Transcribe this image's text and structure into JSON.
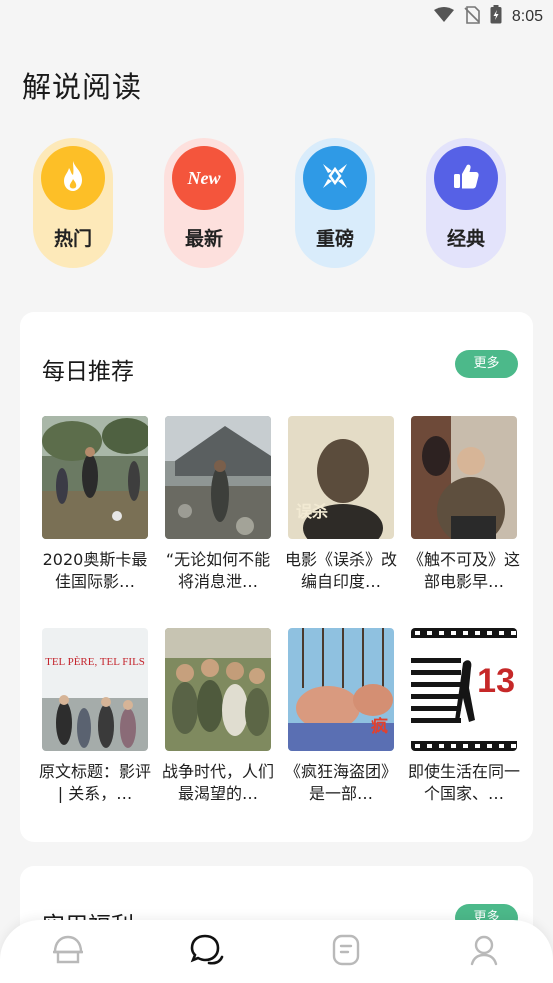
{
  "status_bar": {
    "time": "8:05",
    "icons": [
      "wifi-icon",
      "no-sim-icon",
      "battery-icon"
    ]
  },
  "page_title": "解说阅读",
  "categories": [
    {
      "label": "热门",
      "icon": "fire-icon",
      "bg": "#fde9b9",
      "circle": "#fdbf27"
    },
    {
      "label": "最新",
      "icon": "new-badge-icon",
      "icon_text": "New",
      "bg": "#fde0dd",
      "circle": "#f4553c"
    },
    {
      "label": "重磅",
      "icon": "burst-icon",
      "bg": "#d9ecfb",
      "circle": "#2f9ae6"
    },
    {
      "label": "经典",
      "icon": "thumbs-up-icon",
      "bg": "#e3e3fb",
      "circle": "#5661e6"
    }
  ],
  "daily": {
    "title": "每日推荐",
    "more": "更多",
    "items": [
      {
        "caption": "2020奥斯卡最佳国际影…"
      },
      {
        "caption": "“无论如何不能将消息泄…"
      },
      {
        "caption": "电影《误杀》改编自印度…"
      },
      {
        "caption": "《触不可及》这部电影早…"
      },
      {
        "caption": "原文标题：影评 | 关系，…"
      },
      {
        "caption": "战争时代，人们最渴望的…"
      },
      {
        "caption": "《疯狂海盗团》是一部…"
      },
      {
        "caption": "即使生活在同一个国家、…"
      }
    ],
    "poster_texts": {
      "p3_title": "误杀",
      "p5_title": "TEL PÈRE, TEL FILS",
      "p7_title": "疯",
      "p8_title": "13"
    }
  },
  "second_section": {
    "title": "实用福利",
    "more": "更多"
  },
  "bottom_nav": [
    "home-icon",
    "chat-icon",
    "document-icon",
    "profile-icon"
  ],
  "accent": "#4cb98a"
}
